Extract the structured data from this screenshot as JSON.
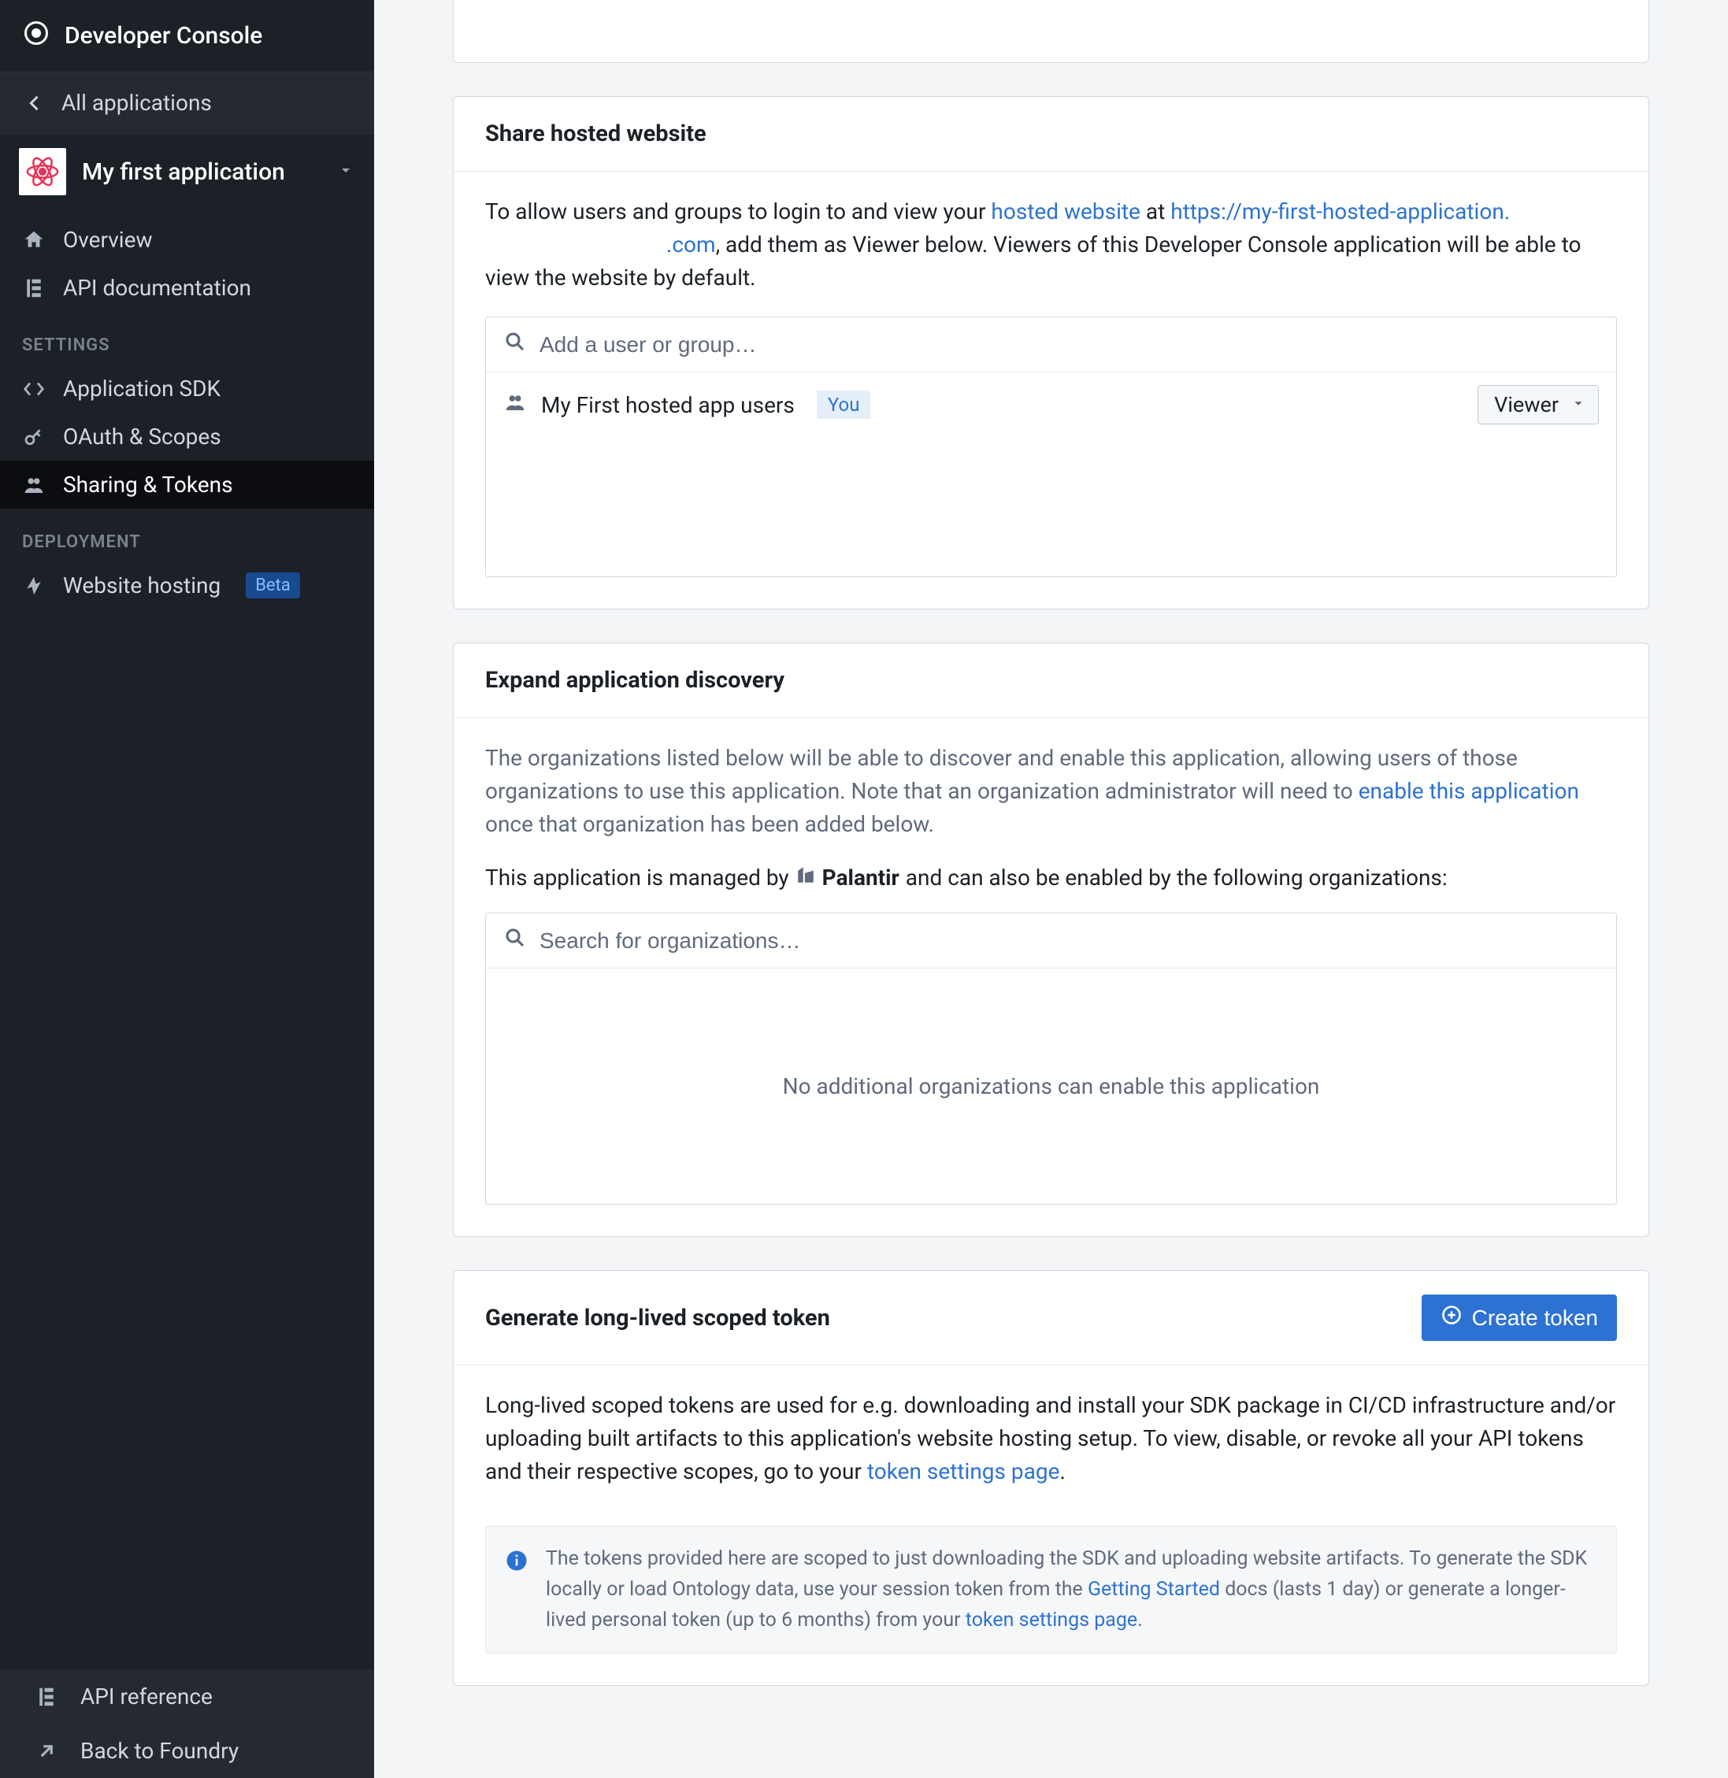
{
  "sidebar": {
    "brand": "Developer Console",
    "back_label": "All applications",
    "app_name": "My first application",
    "nav": {
      "overview": "Overview",
      "api_docs": "API documentation"
    },
    "section_settings": "SETTINGS",
    "settings": {
      "sdk": "Application SDK",
      "oauth": "OAuth & Scopes",
      "sharing": "Sharing & Tokens"
    },
    "section_deployment": "DEPLOYMENT",
    "deployment": {
      "hosting": "Website hosting",
      "beta": "Beta"
    },
    "footer": {
      "api_ref": "API reference",
      "back_foundry": "Back to Foundry"
    }
  },
  "share": {
    "title": "Share hosted website",
    "prefix": "To allow users and groups to login to and view your ",
    "hosted_link_text": "hosted website",
    "at": " at ",
    "url_prefix": "https://my-first-hosted-application.",
    "url_suffix": ".com",
    "suffix": ", add them as Viewer below. Viewers of this Developer Console application will be able to view the website by default.",
    "placeholder": "Add a user or group…",
    "row_name": "My First hosted app users",
    "you": "You",
    "role": "Viewer"
  },
  "discovery": {
    "title": "Expand application discovery",
    "p1a": "The organizations listed below will be able to discover and enable this application, allowing users of those organizations to use this application. Note that an organization administrator will need to ",
    "enable_link": "enable this application",
    "p1b": " once that organization has been added below.",
    "managed_pre": "This application is managed by ",
    "org": "Palantir",
    "managed_post": " and can also be enabled by the following organizations:",
    "placeholder": "Search for organizations…",
    "empty": "No additional organizations can enable this application"
  },
  "token": {
    "title": "Generate long-lived scoped token",
    "create_btn": "Create token",
    "p1a": "Long-lived scoped tokens are used for e.g. downloading and install your SDK package in CI/CD infrastructure and/or uploading built artifacts to this application's website hosting setup. To view, disable, or revoke all your API tokens and their respective scopes, go to your ",
    "settings_link": "token settings page",
    "p1b": ".",
    "callout_a": "The tokens provided here are scoped to just downloading the SDK and uploading website artifacts. To generate the SDK locally or load Ontology data, use your session token from the ",
    "getting_started": "Getting Started",
    "callout_b": " docs (lasts 1 day) or generate a longer-lived personal token (up to 6 months) from your ",
    "callout_link": "token settings page",
    "callout_c": "."
  }
}
